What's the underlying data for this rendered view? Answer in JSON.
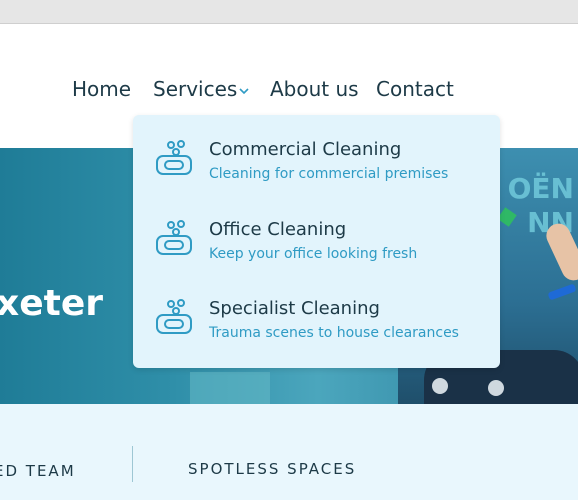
{
  "nav": {
    "home": "Home",
    "services": "Services",
    "about": "About us",
    "contact": "Contact"
  },
  "hero": {
    "title": "xeter",
    "sign_text": "OËN\nNN"
  },
  "dropdown": {
    "items": [
      {
        "title": "Commercial Cleaning",
        "subtitle": "Cleaning for commercial premises",
        "icon": "soap-bubbles-icon"
      },
      {
        "title": "Office Cleaning",
        "subtitle": "Keep your office looking fresh",
        "icon": "soap-bubbles-icon"
      },
      {
        "title": "Specialist Cleaning",
        "subtitle": "Trauma scenes to house clearances",
        "icon": "soap-bubbles-icon"
      }
    ]
  },
  "strip": {
    "left": "ED TEAM",
    "right": "SPOTLESS SPACES"
  },
  "colors": {
    "accent": "#2f9bc4",
    "text": "#1d3a47",
    "dropdown_bg": "#e2f4fc"
  }
}
